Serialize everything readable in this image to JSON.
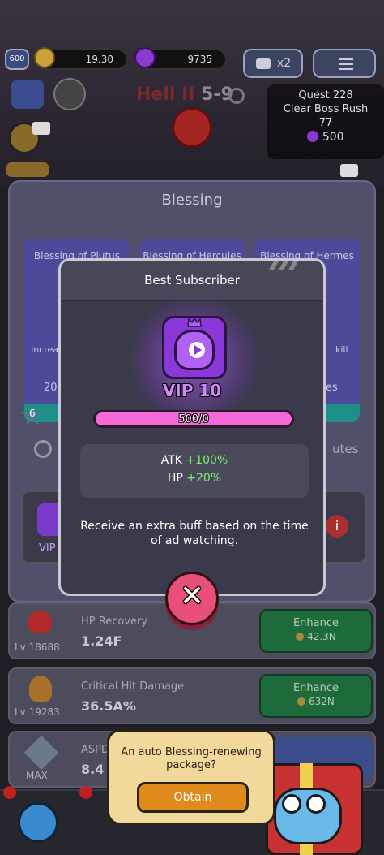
{
  "hud": {
    "level": "600",
    "gold": "19.30",
    "gems": "9735",
    "speed_label": "x2",
    "stage_prefix": "Hell II",
    "stage": "5-9",
    "quest_title": "Quest 228",
    "quest_task": "Clear Boss Rush",
    "quest_count": "77",
    "quest_reward": "500"
  },
  "blessing": {
    "title": "Blessing",
    "cards": [
      {
        "name": "Blessing of Plutus"
      },
      {
        "name": "Blessing of Hercules"
      },
      {
        "name": "Blessing of Hermes"
      }
    ],
    "partial_left_1": "Increa",
    "partial_left_2": "20",
    "partial_right_1": "kill",
    "partial_right_2": "es",
    "partial_row": "utes",
    "star_level": "6",
    "vip_partial": "VIP"
  },
  "stats": [
    {
      "name": "HP Recovery",
      "value": "1.24F",
      "level": "Lv 18688",
      "enhance": "Enhance",
      "cost": "42.3N"
    },
    {
      "name": "Critical Hit Damage",
      "value": "36.5A%",
      "level": "Lv 19283",
      "enhance": "Enhance",
      "cost": "632N"
    },
    {
      "name": "ASPD",
      "value": "8.4",
      "level": "MAX"
    }
  ],
  "tooltip": {
    "question": "An auto Blessing-renewing package?",
    "button": "Obtain"
  },
  "dialog": {
    "title": "Best Subscriber",
    "vip_label": "VIP 10",
    "progress_text": "500/0",
    "progress_fraction": 1.0,
    "atk_label": "ATK",
    "atk_value": "+100%",
    "hp_label": "HP",
    "hp_value": "+20%",
    "description": "Receive an extra buff based on the time of ad watching.",
    "close_icon": "close-x-icon"
  },
  "colors": {
    "accent_purple": "#b061f2",
    "progress_pink": "#f468d8",
    "bonus_green": "#7cf06a",
    "close_red": "#e8507a"
  }
}
